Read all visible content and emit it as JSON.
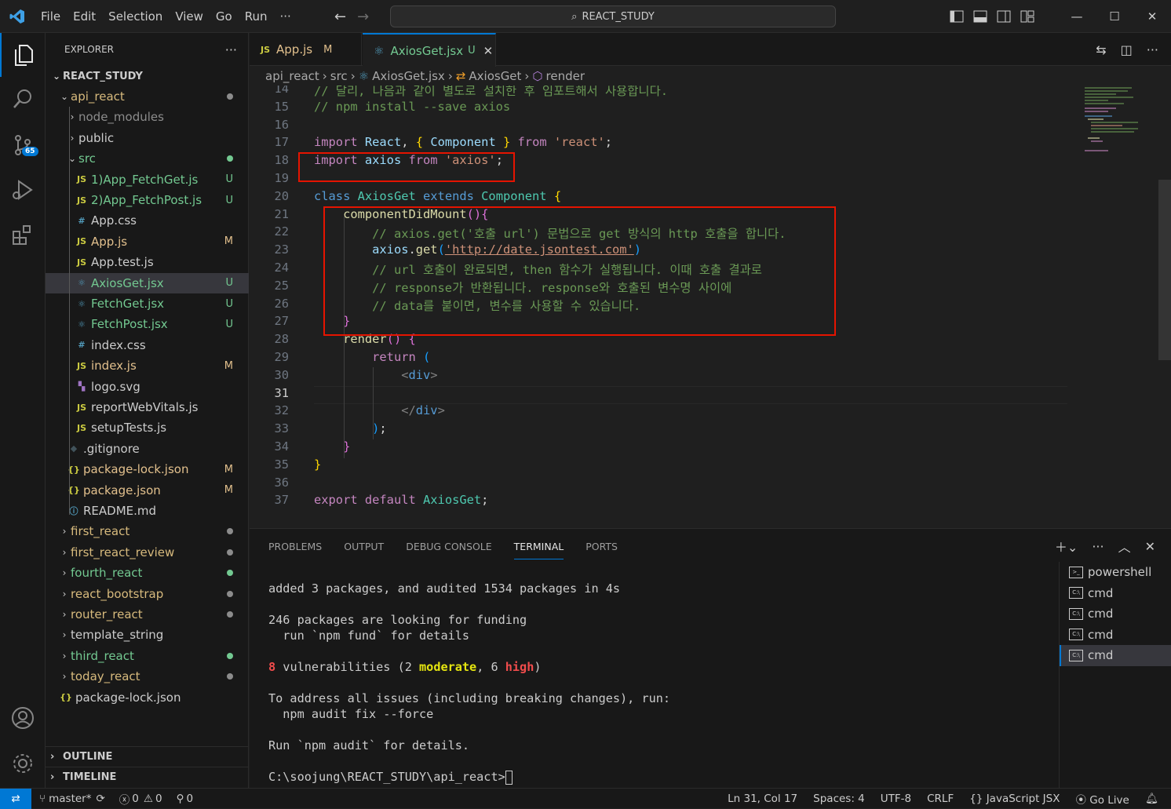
{
  "titlebar": {
    "menus": [
      "File",
      "Edit",
      "Selection",
      "View",
      "Go",
      "Run",
      "···"
    ],
    "search_text": "REACT_STUDY"
  },
  "activitybar": {
    "scm_badge": "65"
  },
  "explorer": {
    "header": "EXPLORER",
    "more": "···",
    "root": "REACT_STUDY",
    "items": [
      {
        "label": "api_react",
        "type": "folder-open",
        "color": "#d7ba7d",
        "dot": "#8c8c8c"
      },
      {
        "label": "node_modules",
        "type": "folder",
        "color": "#8c8c8c"
      },
      {
        "label": "public",
        "type": "folder",
        "color": "#cccccc"
      },
      {
        "label": "src",
        "type": "folder-open",
        "color": "#73c991",
        "dot": "#73c991"
      },
      {
        "label": "1)App_FetchGet.js",
        "icon": "JS",
        "iconColor": "#cbcb41",
        "color": "#73c991",
        "status": "U"
      },
      {
        "label": "2)App_FetchPost.js",
        "icon": "JS",
        "iconColor": "#cbcb41",
        "color": "#73c991",
        "status": "U"
      },
      {
        "label": "App.css",
        "icon": "#",
        "iconColor": "#519aba",
        "color": "#cccccc"
      },
      {
        "label": "App.js",
        "icon": "JS",
        "iconColor": "#cbcb41",
        "color": "#e2c08d",
        "status": "M"
      },
      {
        "label": "App.test.js",
        "icon": "JS",
        "iconColor": "#cbcb41",
        "color": "#cccccc"
      },
      {
        "label": "AxiosGet.jsx",
        "icon": "⚛",
        "iconColor": "#519aba",
        "color": "#73c991",
        "status": "U",
        "selected": true
      },
      {
        "label": "FetchGet.jsx",
        "icon": "⚛",
        "iconColor": "#519aba",
        "color": "#73c991",
        "status": "U"
      },
      {
        "label": "FetchPost.jsx",
        "icon": "⚛",
        "iconColor": "#519aba",
        "color": "#73c991",
        "status": "U"
      },
      {
        "label": "index.css",
        "icon": "#",
        "iconColor": "#519aba",
        "color": "#cccccc"
      },
      {
        "label": "index.js",
        "icon": "JS",
        "iconColor": "#cbcb41",
        "color": "#e2c08d",
        "status": "M"
      },
      {
        "label": "logo.svg",
        "icon": "▚",
        "iconColor": "#a074c4",
        "color": "#cccccc"
      },
      {
        "label": "reportWebVitals.js",
        "icon": "JS",
        "iconColor": "#cbcb41",
        "color": "#cccccc"
      },
      {
        "label": "setupTests.js",
        "icon": "JS",
        "iconColor": "#cbcb41",
        "color": "#cccccc"
      },
      {
        "label": ".gitignore",
        "icon": "◆",
        "iconColor": "#41535b",
        "color": "#cccccc"
      },
      {
        "label": "package-lock.json",
        "icon": "{}",
        "iconColor": "#cbcb41",
        "color": "#e2c08d",
        "status": "M"
      },
      {
        "label": "package.json",
        "icon": "{}",
        "iconColor": "#cbcb41",
        "color": "#e2c08d",
        "status": "M"
      },
      {
        "label": "README.md",
        "icon": "ⓘ",
        "iconColor": "#519aba",
        "color": "#cccccc"
      },
      {
        "label": "first_react",
        "type": "folder",
        "color": "#d7ba7d",
        "dot": "#8c8c8c"
      },
      {
        "label": "first_react_review",
        "type": "folder",
        "color": "#d7ba7d",
        "dot": "#8c8c8c"
      },
      {
        "label": "fourth_react",
        "type": "folder",
        "color": "#73c991",
        "dot": "#73c991"
      },
      {
        "label": "react_bootstrap",
        "type": "folder",
        "color": "#d7ba7d",
        "dot": "#8c8c8c"
      },
      {
        "label": "router_react",
        "type": "folder",
        "color": "#d7ba7d",
        "dot": "#8c8c8c"
      },
      {
        "label": "template_string",
        "type": "folder",
        "color": "#cccccc"
      },
      {
        "label": "third_react",
        "type": "folder",
        "color": "#73c991",
        "dot": "#73c991"
      },
      {
        "label": "today_react",
        "type": "folder",
        "color": "#d7ba7d",
        "dot": "#8c8c8c"
      },
      {
        "label": "package-lock.json",
        "icon": "{}",
        "iconColor": "#cbcb41",
        "color": "#cccccc"
      }
    ],
    "outline": "OUTLINE",
    "timeline": "TIMELINE"
  },
  "tabs": [
    {
      "icon": "JS",
      "label": "App.js",
      "status": "M"
    },
    {
      "icon": "⚛",
      "label": "AxiosGet.jsx",
      "status": "U",
      "close": "✕"
    }
  ],
  "breadcrumbs": [
    "api_react",
    "src",
    "AxiosGet.jsx",
    "AxiosGet",
    "render"
  ],
  "code": [
    {
      "n": "14",
      "t": [
        [
          "cm",
          "// 달리, 나음과 같이 별도로 설치한 후 임포트해서 사용합니다."
        ]
      ]
    },
    {
      "n": "15",
      "t": [
        [
          "cm",
          "// npm install --save axios"
        ]
      ]
    },
    {
      "n": "16",
      "t": []
    },
    {
      "n": "17",
      "t": [
        [
          "kc",
          "import "
        ],
        [
          "vr",
          "React"
        ],
        [
          "pl",
          ", "
        ],
        [
          "br1",
          "{ "
        ],
        [
          "vr",
          "Component"
        ],
        [
          "br1",
          " }"
        ],
        [
          "kc",
          " from "
        ],
        [
          "str",
          "'react'"
        ],
        [
          "pl",
          ";"
        ]
      ]
    },
    {
      "n": "18",
      "t": [
        [
          "kc",
          "import "
        ],
        [
          "vr",
          "axios"
        ],
        [
          "kc",
          " from "
        ],
        [
          "str",
          "'axios'"
        ],
        [
          "pl",
          ";"
        ]
      ]
    },
    {
      "n": "19",
      "t": []
    },
    {
      "n": "20",
      "t": [
        [
          "kw",
          "class "
        ],
        [
          "cl",
          "AxiosGet"
        ],
        [
          "kw",
          " extends "
        ],
        [
          "cl",
          "Component"
        ],
        [
          "br1",
          " {"
        ]
      ]
    },
    {
      "n": "21",
      "t": [
        [
          "pl",
          "    "
        ],
        [
          "fn",
          "componentDidMount"
        ],
        [
          "br2",
          "(){"
        ]
      ]
    },
    {
      "n": "22",
      "t": [
        [
          "pl",
          "        "
        ],
        [
          "cm",
          "// axios.get('호출 url') 문법으로 get 방식의 http 호출을 합니다."
        ]
      ]
    },
    {
      "n": "23",
      "t": [
        [
          "pl",
          "        "
        ],
        [
          "vr",
          "axios"
        ],
        [
          "pl",
          "."
        ],
        [
          "fn",
          "get"
        ],
        [
          "br3",
          "("
        ],
        [
          "str",
          "'http://date.jsontest.com'"
        ],
        [
          "br3",
          ")"
        ]
      ]
    },
    {
      "n": "24",
      "t": [
        [
          "pl",
          "        "
        ],
        [
          "cm",
          "// url 호출이 완료되면, then 함수가 실행됩니다. 이때 호출 결과로"
        ]
      ]
    },
    {
      "n": "25",
      "t": [
        [
          "pl",
          "        "
        ],
        [
          "cm",
          "// response가 반환됩니다. response와 호출된 변수명 사이에"
        ]
      ]
    },
    {
      "n": "26",
      "t": [
        [
          "pl",
          "        "
        ],
        [
          "cm",
          "// data를 붙이면, 변수를 사용할 수 있습니다."
        ]
      ]
    },
    {
      "n": "27",
      "t": [
        [
          "pl",
          "    "
        ],
        [
          "br2",
          "}"
        ]
      ]
    },
    {
      "n": "28",
      "t": [
        [
          "pl",
          "    "
        ],
        [
          "fn",
          "render"
        ],
        [
          "br2",
          "()"
        ],
        [
          "br2",
          " {"
        ]
      ]
    },
    {
      "n": "29",
      "t": [
        [
          "pl",
          "        "
        ],
        [
          "kc",
          "return "
        ],
        [
          "br3",
          "("
        ]
      ]
    },
    {
      "n": "30",
      "t": [
        [
          "pl",
          "            "
        ],
        [
          "tag",
          "<"
        ],
        [
          "tn",
          "div"
        ],
        [
          "tag",
          ">"
        ]
      ]
    },
    {
      "n": "31",
      "t": [],
      "current": true
    },
    {
      "n": "32",
      "t": [
        [
          "pl",
          "            "
        ],
        [
          "tag",
          "</"
        ],
        [
          "tn",
          "div"
        ],
        [
          "tag",
          ">"
        ]
      ]
    },
    {
      "n": "33",
      "t": [
        [
          "pl",
          "        "
        ],
        [
          "br3",
          ")"
        ],
        [
          "pl",
          ";"
        ]
      ]
    },
    {
      "n": "34",
      "t": [
        [
          "pl",
          "    "
        ],
        [
          "br2",
          "}"
        ]
      ]
    },
    {
      "n": "35",
      "t": [
        [
          "br1",
          "}"
        ]
      ]
    },
    {
      "n": "36",
      "t": []
    },
    {
      "n": "37",
      "t": [
        [
          "kc",
          "export "
        ],
        [
          "kc",
          "default "
        ],
        [
          "cl",
          "AxiosGet"
        ],
        [
          "pl",
          ";"
        ]
      ]
    }
  ],
  "panel": {
    "tabs": [
      "PROBLEMS",
      "OUTPUT",
      "DEBUG CONSOLE",
      "TERMINAL",
      "PORTS"
    ],
    "active_tab": "TERMINAL",
    "terminal_lines": [
      [
        [
          "",
          "added 3 packages, and audited 1534 packages in 4s"
        ]
      ],
      [
        [
          "",
          ""
        ]
      ],
      [
        [
          "",
          "246 packages are looking for funding"
        ]
      ],
      [
        [
          "",
          "  run `npm fund` for details"
        ]
      ],
      [
        [
          "",
          ""
        ]
      ],
      [
        [
          "red",
          "8"
        ],
        [
          "",
          " vulnerabilities (2 "
        ],
        [
          "yellow",
          "moderate"
        ],
        [
          "",
          ", 6 "
        ],
        [
          "red",
          "high"
        ],
        [
          "",
          ")"
        ]
      ],
      [
        [
          "",
          ""
        ]
      ],
      [
        [
          "",
          "To address all issues (including breaking changes), run:"
        ]
      ],
      [
        [
          "",
          "  npm audit fix --force"
        ]
      ],
      [
        [
          "",
          ""
        ]
      ],
      [
        [
          "",
          "Run `npm audit` for details."
        ]
      ],
      [
        [
          "",
          ""
        ]
      ],
      [
        [
          "",
          "C:\\soojung\\REACT_STUDY\\api_react>"
        ]
      ]
    ],
    "terminals": [
      {
        "label": "powershell"
      },
      {
        "label": "cmd"
      },
      {
        "label": "cmd"
      },
      {
        "label": "cmd"
      },
      {
        "label": "cmd",
        "active": true
      }
    ]
  },
  "statusbar": {
    "branch": "master*",
    "errors": "0",
    "warnings": "0",
    "ports": "0",
    "position": "Ln 31, Col 17",
    "spaces": "Spaces: 4",
    "encoding": "UTF-8",
    "eol": "CRLF",
    "language": "JavaScript JSX",
    "golive": "Go Live"
  }
}
